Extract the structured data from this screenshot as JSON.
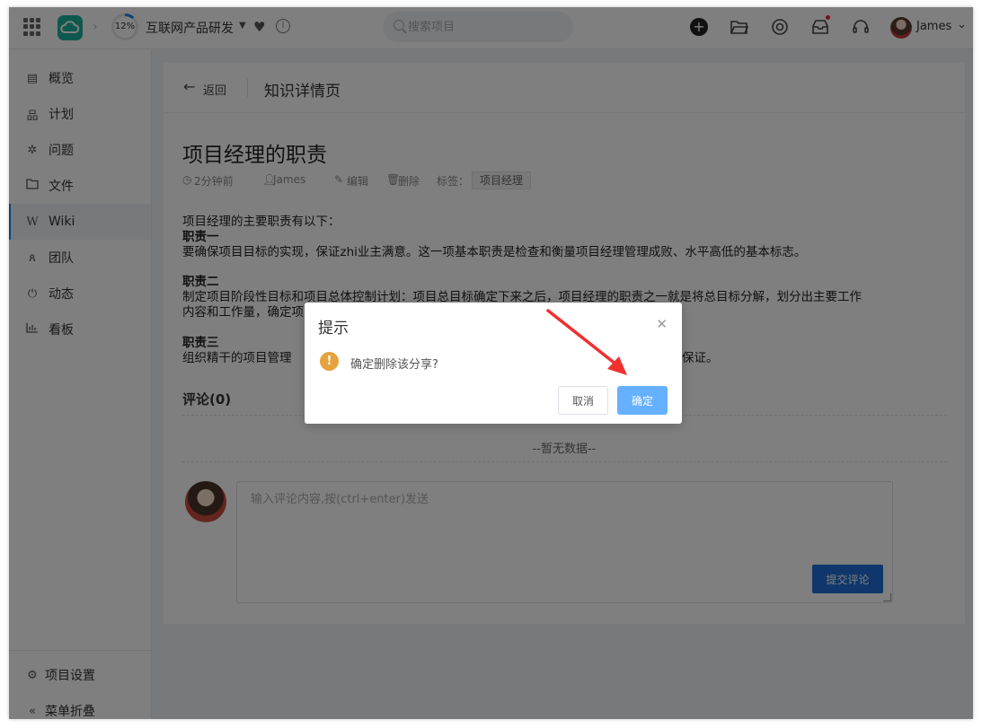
{
  "topbar": {
    "progress": "12%",
    "progress_value": 0.12,
    "project_name": "互联网产品研发",
    "search_placeholder": "搜索项目",
    "user_name": "James"
  },
  "sidebar": {
    "items": [
      {
        "label": "概览",
        "icon": "overview-icon"
      },
      {
        "label": "计划",
        "icon": "plan-icon"
      },
      {
        "label": "问题",
        "icon": "bug-icon"
      },
      {
        "label": "文件",
        "icon": "folder-icon"
      },
      {
        "label": "Wiki",
        "icon": "wiki-icon",
        "active": true
      },
      {
        "label": "团队",
        "icon": "team-icon"
      },
      {
        "label": "动态",
        "icon": "activity-icon"
      },
      {
        "label": "看板",
        "icon": "board-icon"
      }
    ],
    "settings_label": "项目设置",
    "collapse_label": "菜单折叠"
  },
  "header": {
    "back_label": "返回",
    "title": "知识详情页"
  },
  "doc": {
    "title": "项目经理的职责",
    "time": "2分钟前",
    "author": "James",
    "edit_label": "编辑",
    "delete_label": "删除",
    "tags_label": "标签：",
    "tag": "项目经理",
    "lines": [
      "项目经理的主要职责有以下：",
      "职责一",
      "要确保项目目标的实现，保证zhi业主满意。这一项基本职责是检查和衡量项目经理管理成败、水平高低的基本标志。",
      "职责二",
      "制定项目阶段性目标和项目总体控制计划：项目总目标确定下来之后，项目经理的职责之一就是将总目标分解，划分出主要工作",
      "内容和工作量，确定项目阶段性目标的实现标志等。",
      "职责三",
      "组织精干的项目管理",
      "保证。"
    ]
  },
  "comments": {
    "heading": "评论(0)",
    "empty": "--暂无数据--",
    "placeholder": "输入评论内容,按(ctrl+enter)发送",
    "submit_label": "提交评论"
  },
  "dialog": {
    "title": "提示",
    "message": "确定删除该分享?",
    "cancel_label": "取消",
    "confirm_label": "确定"
  },
  "colors": {
    "primary": "#1e6fd9",
    "confirm": "#66b1ff",
    "warning": "#e6a23c",
    "logo": "#1fb19c",
    "annotation_arrow": "#f0302f"
  }
}
